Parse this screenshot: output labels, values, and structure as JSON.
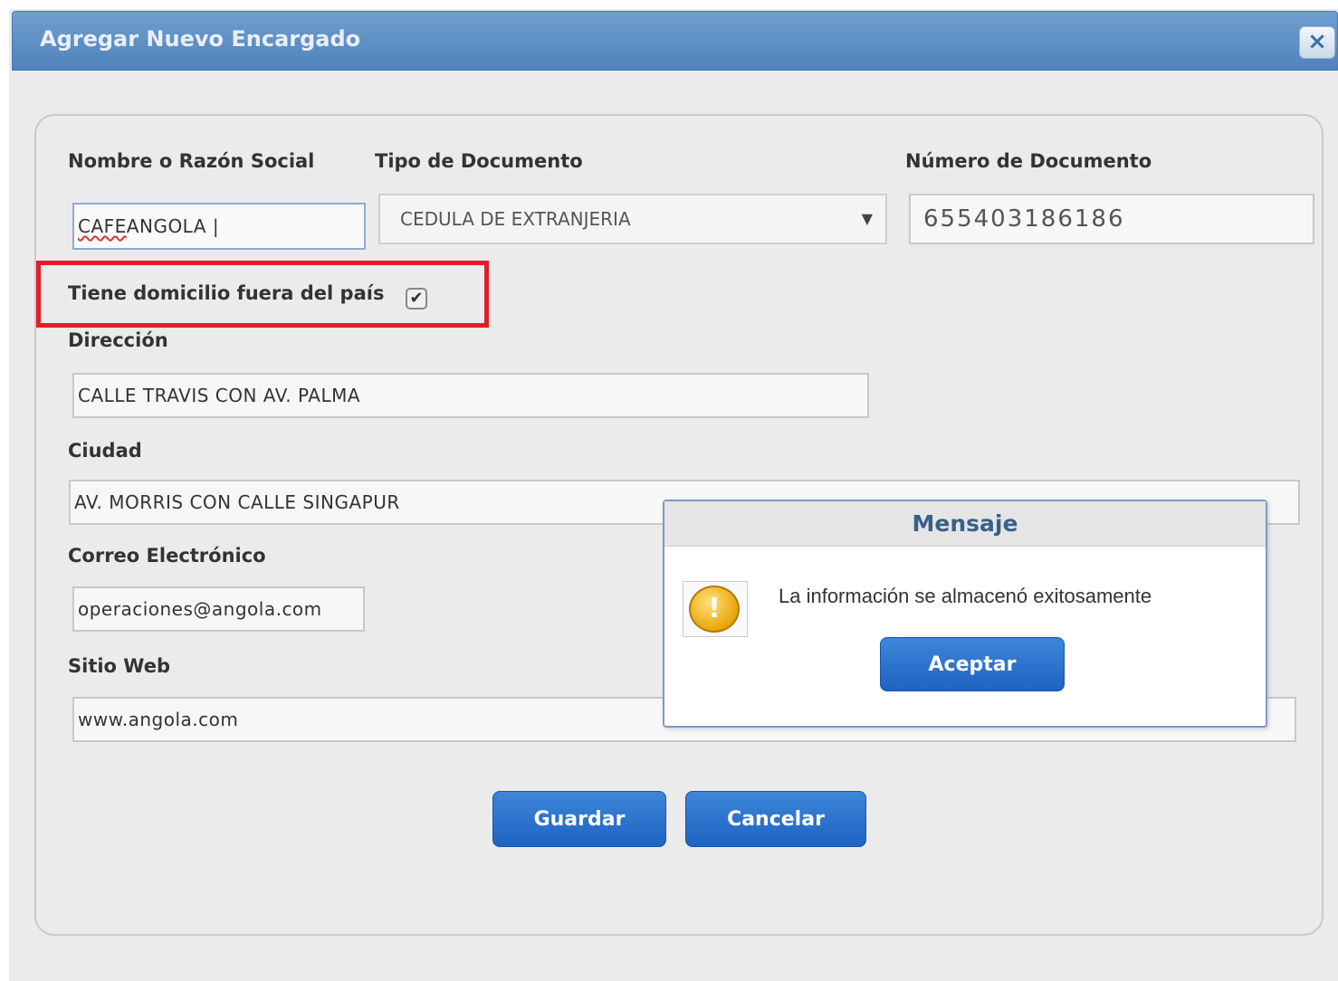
{
  "dialog": {
    "title": "Agregar Nuevo Encargado",
    "close_icon": "×"
  },
  "form": {
    "nombre_label": "Nombre o Razón Social",
    "nombre_value_word1": "CAFE",
    "nombre_value_rest": " ANGOLA |",
    "tipo_label": "Tipo de Documento",
    "tipo_value": "CEDULA DE EXTRANJERIA",
    "tipo_arrow": "▼",
    "numero_label": "Número de Documento",
    "numero_value": "655403186186",
    "domicilio_label": "Tiene domicilio fuera del país",
    "domicilio_check": "✔",
    "direccion_label": "Dirección",
    "direccion_value": "CALLE TRAVIS CON AV. PALMA",
    "ciudad_label": "Ciudad",
    "ciudad_value": "AV. MORRIS CON CALLE SINGAPUR",
    "correo_label": "Correo Electrónico",
    "correo_value": "operaciones@angola.com",
    "sitio_label": "Sitio Web",
    "sitio_value": "www.angola.com"
  },
  "buttons": {
    "guardar": "Guardar",
    "cancelar": "Cancelar"
  },
  "message": {
    "title": "Mensaje",
    "icon_glyph": "!",
    "text": "La información se almacenó exitosamente",
    "accept": "Aceptar"
  },
  "colors": {
    "titlebar": "#4f83bb",
    "button": "#1e63c0",
    "highlight": "#e11d2a"
  },
  "icons": {
    "close": "close-icon",
    "dropdown": "chevron-down-icon",
    "warning": "warning-icon"
  }
}
